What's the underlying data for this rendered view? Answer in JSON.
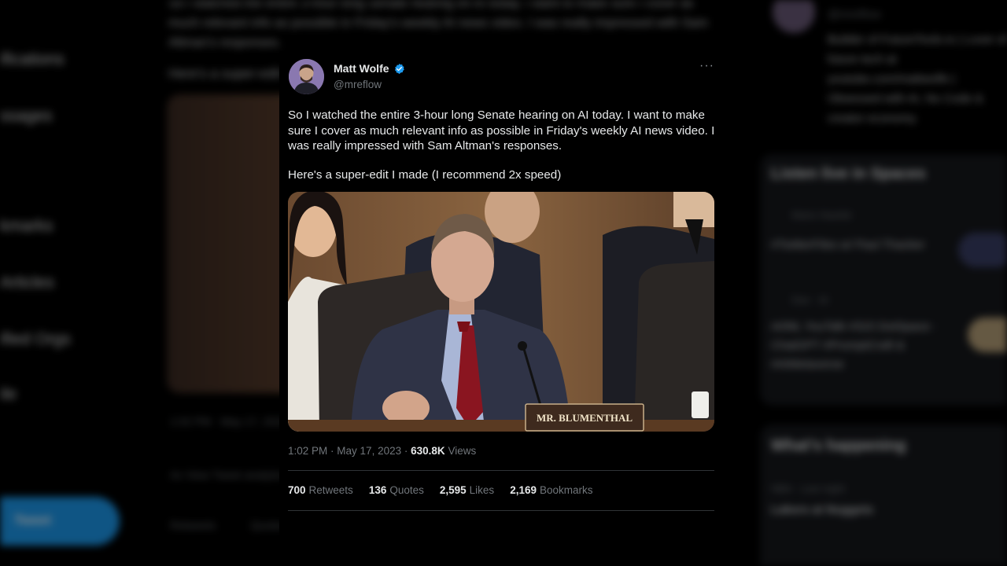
{
  "background": {
    "nav_items": [
      "ifications",
      "ssages",
      "kmarks",
      "Articles",
      "ified Orgs",
      "ile"
    ],
    "post_button": "Tweet",
    "blurred_tweet_text": "So I watched the entire 3-hour long Senate hearing on AI today. I want to make sure I cover as much relevant info as possible in Friday's weekly AI news video. I was really impressed with Sam Altman's responses.",
    "blurred_tweet_p2": "Here's a super-edit I made (I recommend 2x speed)",
    "blurred_meta": "1:02 PM · May 17, 2023",
    "blurred_meta2": "Av   View Tweet analytics",
    "blurred_stats": "Retweets Quotes Likes Bookmarks",
    "profile_handle": "@mreflow",
    "profile_bio": "Builder of FutureTools.io | Lover of future tech at youtube.com/mattwolfe | Obsessed with AI, No Code & creator economy.",
    "spaces_title": "Listen live in Spaces",
    "spaces_host1": "Mario Nawfal",
    "spaces_item1": "#TwitterFiles w/ Paul Thacker",
    "spaces_host2": "Dan · AI",
    "spaces_item2": "AI/ML YouTalk #315 DotSpace · ChatGPT #PromptCraft & #AIMetaverse",
    "happening_title": "What's happening",
    "happening_sub": "NBA · Last night",
    "happening_item": "Lakers at Nuggets"
  },
  "tweet": {
    "author_name": "Matt Wolfe",
    "author_handle": "@mreflow",
    "more_label": "···",
    "text_p1": "So I watched the entire 3-hour long Senate hearing on AI today. I want to make sure I cover as much relevant info as possible in Friday's weekly AI news video. I was really impressed with Sam Altman's responses.",
    "text_p2": "Here's a super-edit I made (I recommend 2x speed)",
    "video_nameplate": "MR. BLUMENTHAL",
    "time": "1:02 PM",
    "date": "May 17, 2023",
    "views_count": "630.8K",
    "views_label": "Views",
    "stats": [
      {
        "count": "700",
        "label": "Retweets"
      },
      {
        "count": "136",
        "label": "Quotes"
      },
      {
        "count": "2,595",
        "label": "Likes"
      },
      {
        "count": "2,169",
        "label": "Bookmarks"
      }
    ]
  },
  "colors": {
    "background": "#000000",
    "text_primary": "#e7e9ea",
    "text_secondary": "#71767b",
    "accent": "#1d9bf0",
    "divider": "#2f3336"
  },
  "icons": {
    "verified": "verified-badge-icon",
    "more": "more-options-icon"
  }
}
